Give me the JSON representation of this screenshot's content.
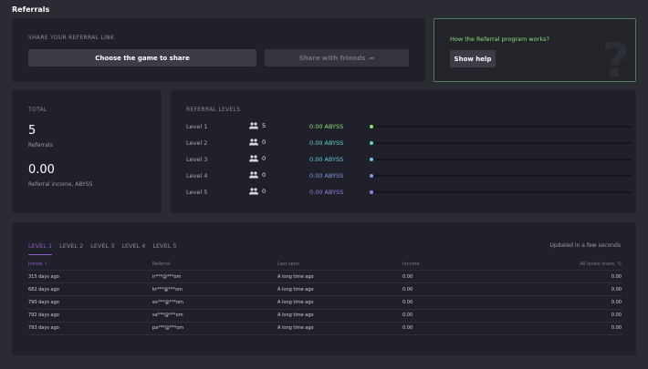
{
  "page": {
    "title": "Referrals"
  },
  "share": {
    "title": "SHARE YOUR REFERRAL LINK",
    "choose_label": "Choose the game to share",
    "share_friends_label": "Share with friends"
  },
  "help": {
    "question": "How the Referral program works?",
    "button": "Show help",
    "decor": "?"
  },
  "totals": {
    "label": "TOTAL",
    "count": "5",
    "count_label": "Referrals",
    "income": "0.00",
    "income_label": "Referral income, ABYSS"
  },
  "levels": {
    "title": "REFERRAL LEVELS",
    "items": [
      {
        "name": "Level 1",
        "count": "5",
        "income": "0.00  ABYSS",
        "color": "#8ee07a",
        "fill": 0
      },
      {
        "name": "Level 2",
        "count": "0",
        "income": "0.00  ABYSS",
        "color": "#5fd3c4",
        "fill": 0
      },
      {
        "name": "Level 3",
        "count": "0",
        "income": "0.00  ABYSS",
        "color": "#62c7e0",
        "fill": 0
      },
      {
        "name": "Level 4",
        "count": "0",
        "income": "0.00  ABYSS",
        "color": "#7c9ae6",
        "fill": 0
      },
      {
        "name": "Level 5",
        "count": "0",
        "income": "0.00  ABYSS",
        "color": "#9b7ce6",
        "fill": 0
      }
    ]
  },
  "table": {
    "tabs": [
      "LEVEL 1",
      "LEVEL 2",
      "LEVEL 3",
      "LEVEL 4",
      "LEVEL 5"
    ],
    "active_tab": "LEVEL 1",
    "updated": "Updated in a few seconds",
    "sort_arrow": "↑",
    "headers": {
      "joined": "Joined",
      "referral": "Referral",
      "last_seen": "Last seen",
      "income": "Income",
      "share": "All levels share, %"
    },
    "rows": [
      {
        "joined": "315 days ago",
        "referral": "ir***@***om",
        "last_seen": "A long time ago",
        "income": "0.00",
        "share": "0.00"
      },
      {
        "joined": "682 days ago",
        "referral": "kr***@***om",
        "last_seen": "A long time ago",
        "income": "0.00",
        "share": "0.00"
      },
      {
        "joined": "790 days ago",
        "referral": "ex***@***om",
        "last_seen": "A long time ago",
        "income": "0.00",
        "share": "0.00"
      },
      {
        "joined": "792 days ago",
        "referral": "sa***@***om",
        "last_seen": "A long time ago",
        "income": "0.00",
        "share": "0.00"
      },
      {
        "joined": "793 days ago",
        "referral": "pa***@***om",
        "last_seen": "A long time ago",
        "income": "0.00",
        "share": "0.00"
      }
    ]
  },
  "colors": {
    "accent_green": "#8ee07a",
    "accent_purple": "#8e5cc9",
    "income_green": "#8ee07a",
    "income_blue": "#8fb8f0"
  }
}
